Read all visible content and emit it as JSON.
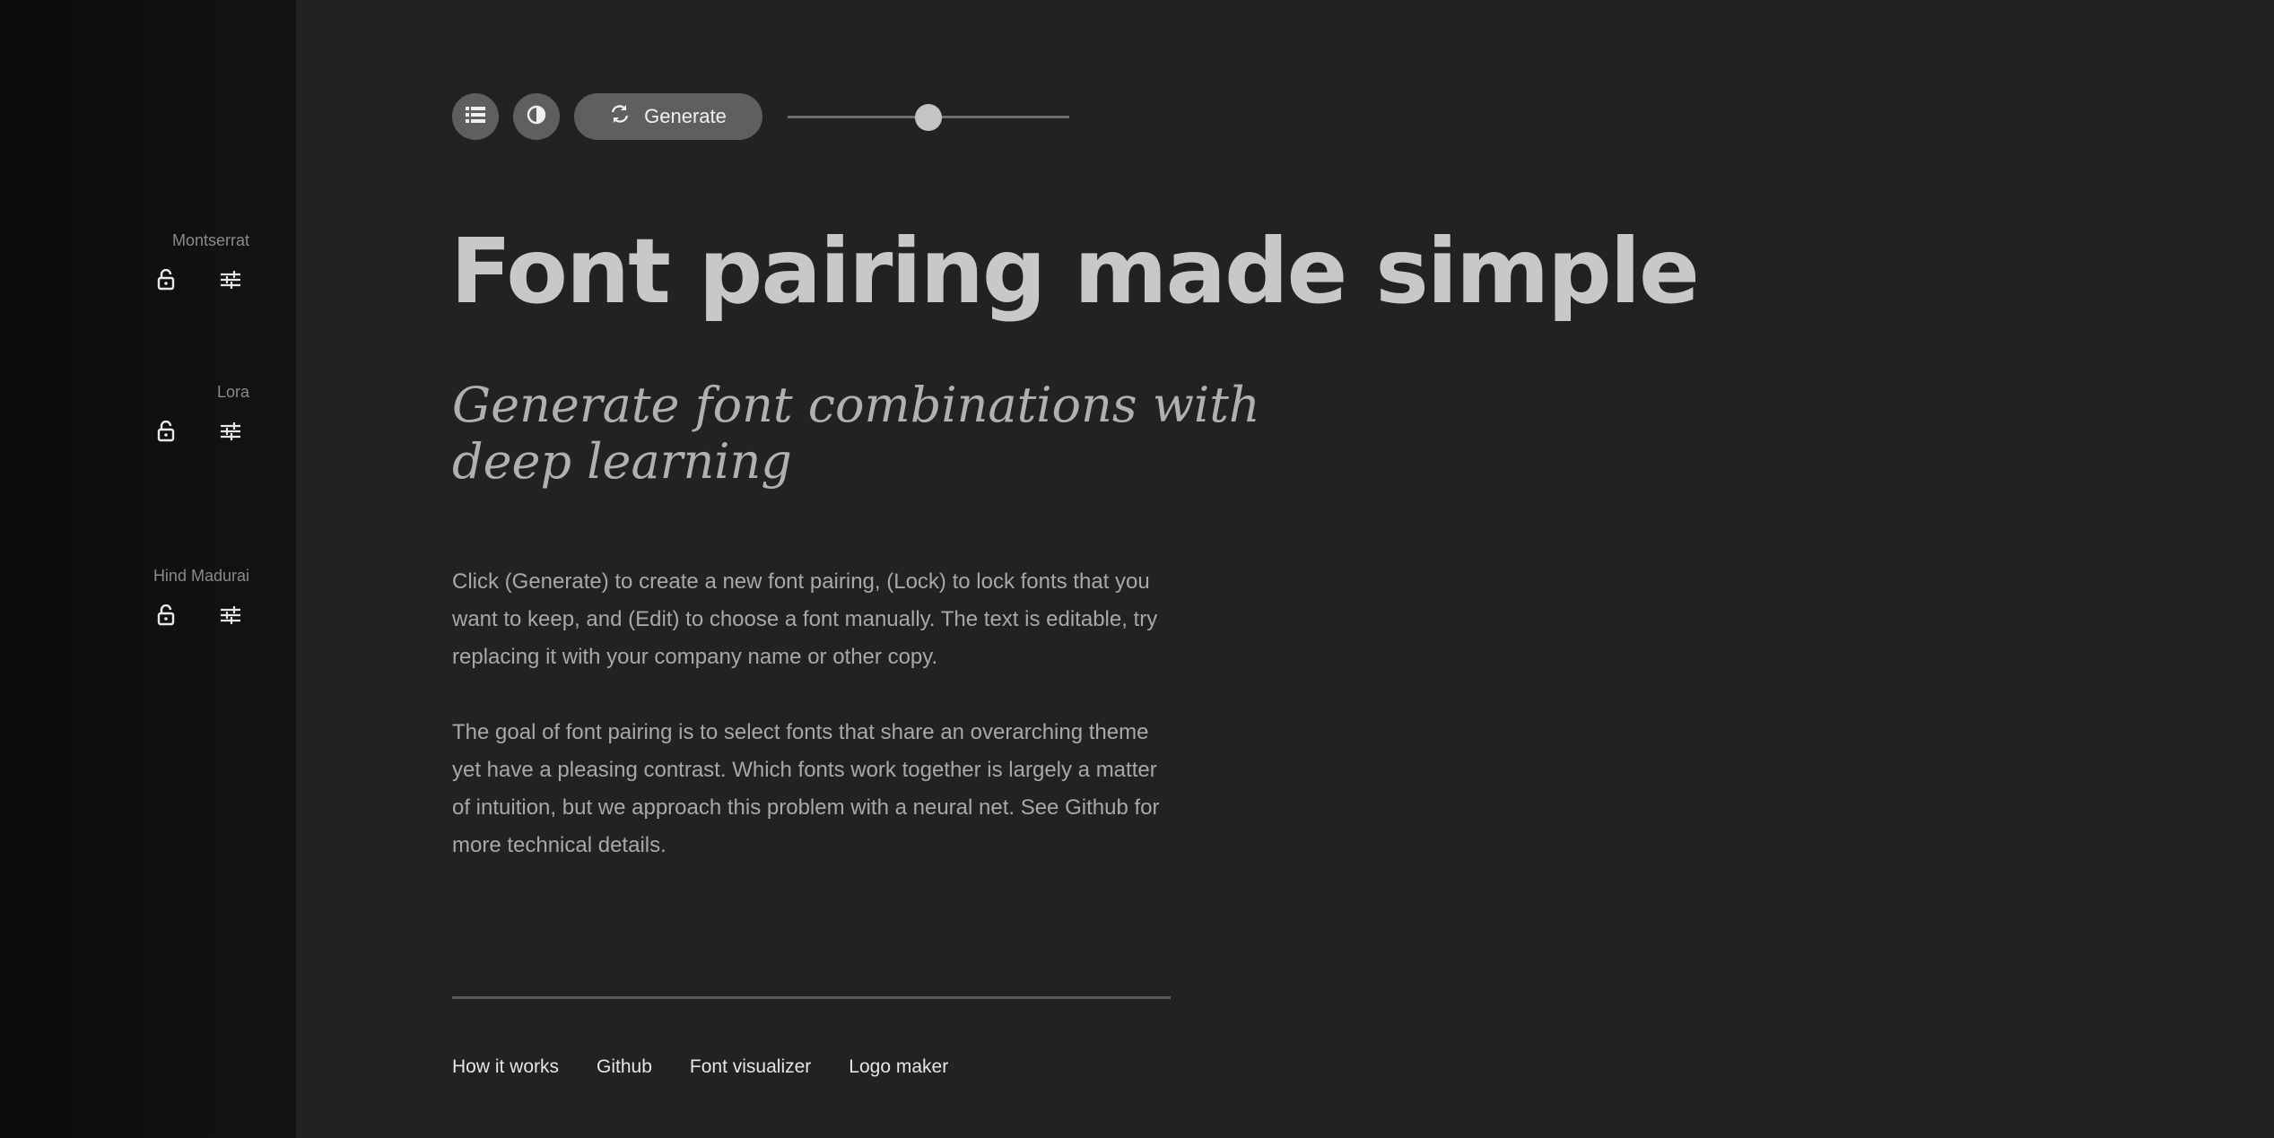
{
  "sidebar": {
    "fonts": [
      {
        "name": "Montserrat",
        "lock_icon": "lock-open-icon",
        "edit_icon": "sliders-icon"
      },
      {
        "name": "Lora",
        "lock_icon": "lock-open-icon",
        "edit_icon": "sliders-icon"
      },
      {
        "name": "Hind Madurai",
        "lock_icon": "lock-open-icon",
        "edit_icon": "sliders-icon"
      }
    ]
  },
  "toolbar": {
    "list_icon": "list-icon",
    "contrast_icon": "contrast-icon",
    "generate_icon": "refresh-icon",
    "generate_label": "Generate",
    "slider_value": 0.5
  },
  "content": {
    "headline": "Font pairing made simple",
    "subheadline": "Generate font combinations with deep learning",
    "paragraph1": "Click (Generate) to create a new font pairing, (Lock) to lock fonts that you want to keep, and (Edit) to choose a font manually. The text is editable, try replacing it with your company name or other copy.",
    "paragraph2": "The goal of font pairing is to select fonts that share an overarching theme yet have a pleasing contrast. Which fonts work together is largely a matter of intuition, but we approach this problem with a neural net. See Github for more technical details."
  },
  "footer": {
    "links": [
      "How it works",
      "Github",
      "Font visualizer",
      "Logo maker"
    ]
  },
  "colors": {
    "background": "#222222",
    "sidebar": "#101010",
    "button": "#5f5f5f",
    "headline": "#c8c8c8",
    "body_text": "#a8a8a8"
  }
}
